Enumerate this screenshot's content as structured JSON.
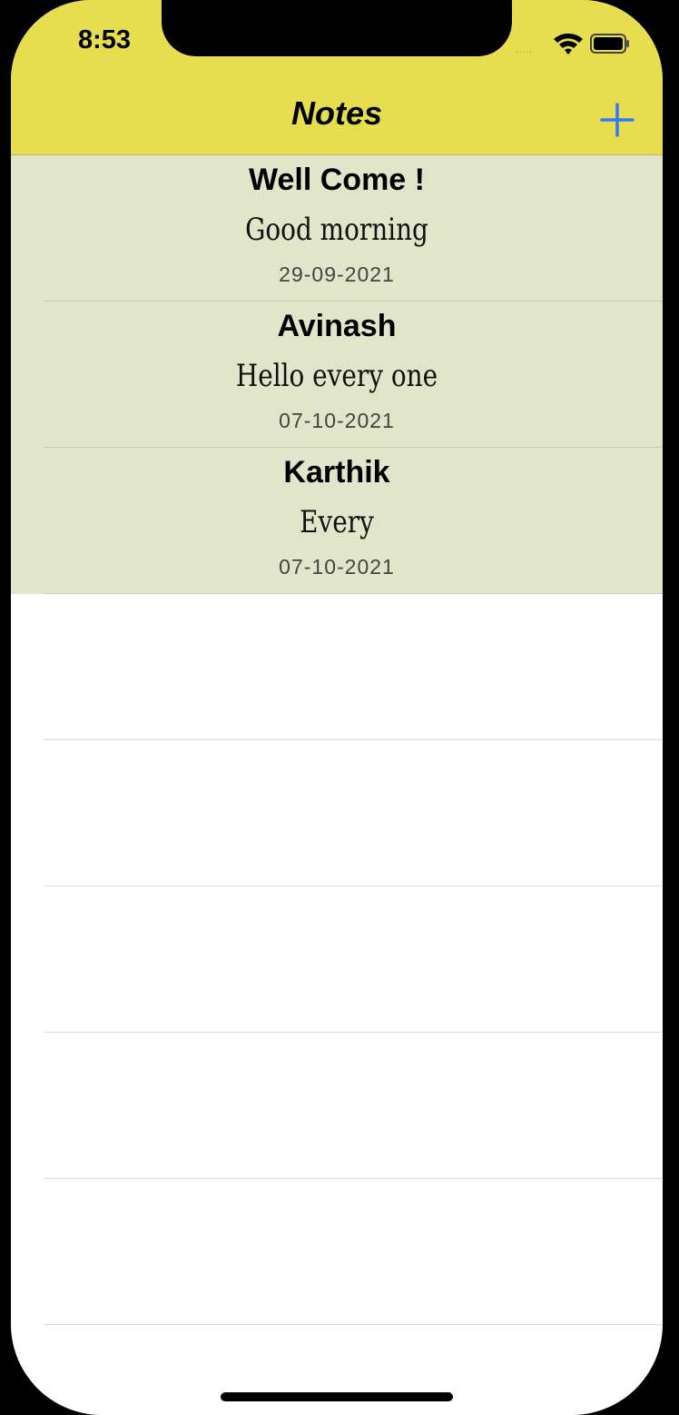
{
  "status_bar": {
    "time": "8:53",
    "signal": "....."
  },
  "nav": {
    "title": "Notes"
  },
  "notes": [
    {
      "title": "Well Come !",
      "body": "Good morning",
      "date": "29-09-2021"
    },
    {
      "title": "Avinash",
      "body": "Hello every one",
      "date": "07-10-2021"
    },
    {
      "title": "Karthik",
      "body": "Every",
      "date": "07-10-2021"
    }
  ],
  "colors": {
    "nav_bar": "#e6dd4f",
    "note_row": "#e1e5c9",
    "accent": "#3478f6"
  },
  "icons": {
    "add": "plus-icon",
    "wifi": "wifi-icon",
    "battery": "battery-icon"
  }
}
